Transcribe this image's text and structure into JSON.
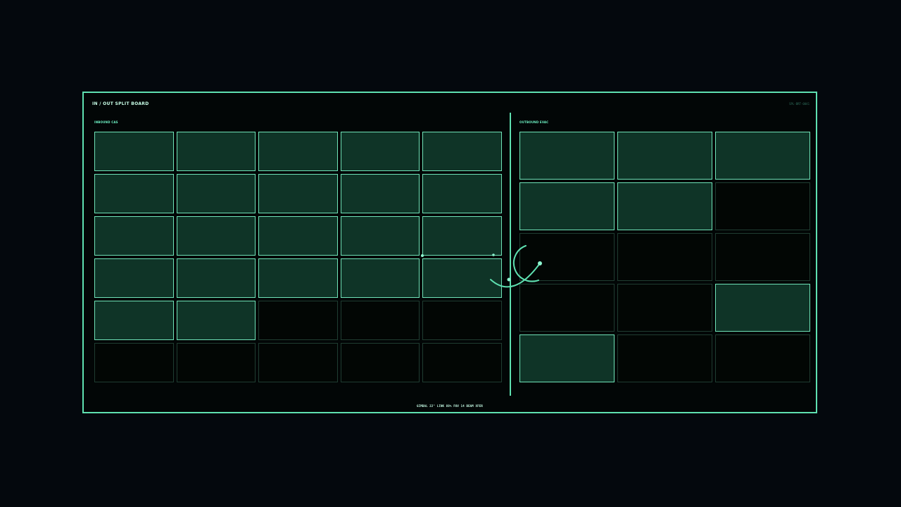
{
  "board": {
    "title": "IN / OUT SPLIT BOARD",
    "code": "SPL-BRT-0041"
  },
  "left_panel": {
    "label": "INBOUND CAS",
    "cells": [
      true,
      true,
      true,
      true,
      true,
      true,
      true,
      true,
      true,
      true,
      true,
      true,
      true,
      true,
      true,
      true,
      true,
      true,
      true,
      true,
      true,
      true,
      false,
      false,
      false,
      false,
      false,
      false,
      false,
      false
    ]
  },
  "right_panel": {
    "label": "OUTBOUND EVAC",
    "cells": [
      true,
      true,
      true,
      true,
      true,
      false,
      false,
      false,
      false,
      false,
      false,
      true,
      true,
      false,
      false
    ]
  },
  "status_bar": {
    "text": "GIMBAL 22°  LINK 88%  FOV 14  BEAM XFER"
  },
  "colors": {
    "accent": "#5ee0b0",
    "cell_fill": "#0f3427",
    "cell_empty": "#020604",
    "background": "#04080d"
  }
}
